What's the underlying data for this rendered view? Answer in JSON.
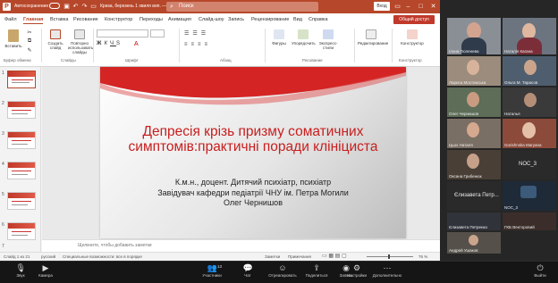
{
  "titlebar": {
    "autosave": "Автосохранение",
    "filename": "Криза, березень 1 хвиля вип. — PowerPoint",
    "search_placeholder": "Поиск",
    "signin": "Вход"
  },
  "ribbon_tabs": [
    "Файл",
    "Главная",
    "Вставка",
    "Рисование",
    "Конструктор",
    "Переходы",
    "Анимация",
    "Слайд-шоу",
    "Запись",
    "Рецензирование",
    "Вид",
    "Справка"
  ],
  "share_label": "Общий доступ",
  "ribbon": {
    "paste": "Вставить",
    "new_slide": "Создать слайд",
    "reuse": "Повторно использовать слайды",
    "shapes": "Фигуры",
    "arrange": "Упорядочить",
    "styles": "Экспресс-стили",
    "editing": "Редактирование",
    "designer": "Конструктор",
    "groups": [
      "Буфер обмена",
      "Слайды",
      "Шрифт",
      "Абзац",
      "Рисование",
      "Конструктор"
    ]
  },
  "thumbnails": [
    "1",
    "2",
    "3",
    "4",
    "5",
    "6",
    "7"
  ],
  "slide": {
    "title": "Депресія крізь призму соматичних симптомів:практичні поради клініциста",
    "subtitle1": "К.м.н., доцент. Дитячий психіатр, психіатр",
    "subtitle2": "Завідувач кафедри педіатрії ЧНУ ім. Петра Могили",
    "subtitle3": "Олег Чернишов"
  },
  "notes_placeholder": "Щелкните, чтобы добавить заметки",
  "status": {
    "slide": "Слайд 1 из 21",
    "lang": "русский",
    "accessibility": "Специальные возможности: все в порядке",
    "notes": "Заметки",
    "comments": "Примечания",
    "zoom": "76 %"
  },
  "participants": [
    {
      "name": "Ілона Тюленева"
    },
    {
      "name": "Наталія Кагана"
    },
    {
      "name": "Лариса Мостинська"
    },
    {
      "name": "Ольга М. Тарасов"
    },
    {
      "name": "Олег Чернишов"
    },
    {
      "name": "Наталья"
    },
    {
      "name": "Цьох Наталя"
    },
    {
      "name": "Gorishnska Maryana"
    },
    {
      "name": "Оксана Грибенюк"
    },
    {
      "name": "NOC_3"
    },
    {
      "name": "Єлизавета Петр..."
    },
    {
      "name": "NOC_3"
    },
    {
      "name": "Єлизавета Петренко"
    },
    {
      "name": "ГКБ Векторовий"
    },
    {
      "name": "Андрей Ушаков"
    }
  ],
  "toolbar": {
    "sound": "Звук",
    "camera": "Камера",
    "participants": "Участники",
    "participants_count": "13",
    "chat": "Чат",
    "react": "Отреагировать",
    "share": "Поделиться",
    "record": "Запись",
    "settings": "Настройки",
    "more": "Дополнительно",
    "leave": "Выйти"
  }
}
